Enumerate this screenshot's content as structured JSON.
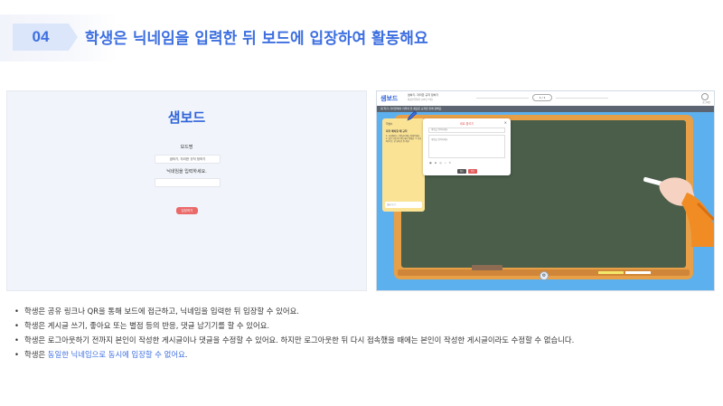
{
  "header": {
    "number": "04",
    "title": "학생은 닉네임을 입력한 뒤 보드에 입장하여 활동해요"
  },
  "login_screen": {
    "logo": "샘보드",
    "board_name_label": "보드명",
    "board_name_value": "샘하기, 자리한 규칙 정하기",
    "nickname_label": "닉네임을 입력하세요.",
    "nickname_value": "",
    "enter_button": "입장하기"
  },
  "board_screen": {
    "logo": "샘보드",
    "board_title": "샘하기, 자리한 규칙 정하기",
    "board_subtitle": "화상수업하기 (03년 7월)",
    "page_indicator": "1 / 1",
    "user_label": "로그아웃",
    "notice": "새 학기, 자리한에서 지켜야 할 새로운 규칙을 함께 정해요.",
    "sticky": {
      "author": "학생1",
      "title": "자리 배치할 때 규칙",
      "body": "1. 자리배치는 선생님이 짝을 정해주세요. 2. 같은 모둠끼리 의논해서 정해요. 3. 자리 바꾸기는 한 달에 한 번 해요.",
      "reply_placeholder": "댓글 쓰기"
    },
    "modal": {
      "title": "새로 올리기",
      "close": "×",
      "title_placeholder": "제목을 입력하세요.",
      "body_placeholder": "내용을 입력하세요.",
      "tools": "▣ ⊞ ◎ ⌁ ✎",
      "cancel": "취소",
      "submit": "완료"
    },
    "settings_icon": "⚙"
  },
  "bullets": [
    {
      "text": "학생은 공유 링크나 QR을 통해 보드에 접근하고, 닉네임을 입력한 뒤 입장할 수 있어요.",
      "highlight": ""
    },
    {
      "text": "학생은 게시글 쓰기, 좋아요 또는 별점 등의 반응, 댓글 남기기를 할 수 있어요.",
      "highlight": ""
    },
    {
      "text": "학생은 로그아웃하기 전까지 본인이 작성한 게시글이나 댓글을 수정할 수 있어요. 하지만 로그아웃한 뒤 다시 접속했을 때에는 본인이 작성한 게시글이라도 수정할 수 없습니다.",
      "highlight": ""
    },
    {
      "text_before": "학생은 ",
      "highlight": "동일한 닉네임으로 동시에 입장할 수 없어요",
      "text_after": "."
    }
  ],
  "colors": {
    "accent": "#3d6fe0",
    "badge_bg": "#dbe6fb",
    "board_sky": "#5db0ee",
    "chalkboard": "#4a5e4a",
    "frame": "#e7a047",
    "sticky": "#fbe396",
    "danger": "#e25a5a"
  }
}
